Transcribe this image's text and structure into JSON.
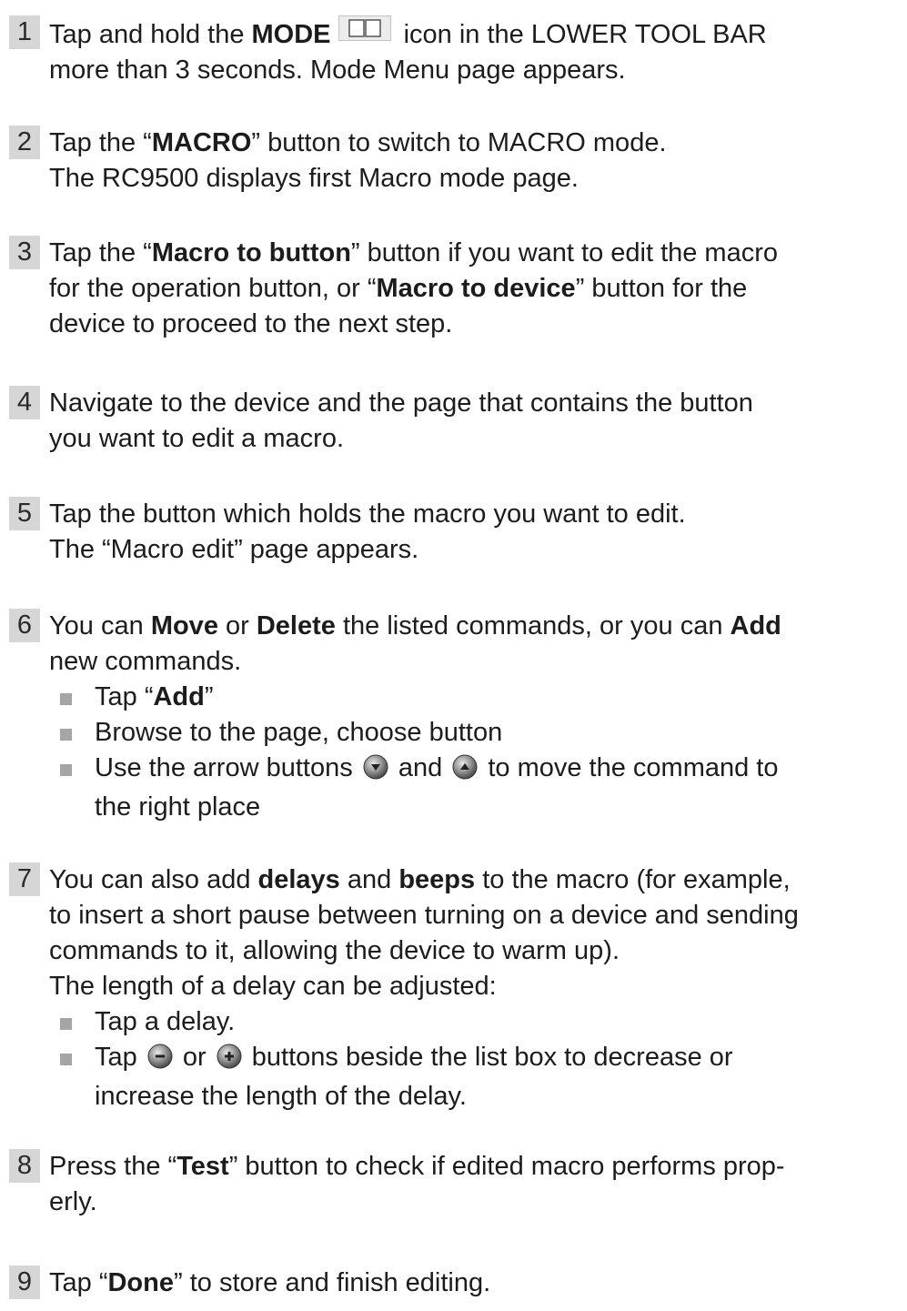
{
  "steps": [
    {
      "num": "1",
      "l1a": "Tap and hold the ",
      "l1b": "MODE",
      "l1c": " icon in the LOWER TOOL BAR",
      "l2": "more than 3 seconds. Mode Menu page appears."
    },
    {
      "num": "2",
      "l1a": "Tap the “",
      "l1b": "MACRO",
      "l1c": "” button to switch to MACRO mode.",
      "l2": "The RC9500 displays first Macro mode page."
    },
    {
      "num": "3",
      "l1a": "Tap the “",
      "l1b": "Macro to button",
      "l1c": "” button if you want to edit the macro",
      "l2a": "for the operation button, or “",
      "l2b": "Macro to device",
      "l2c": "” button for the",
      "l3": "device to proceed to the next step."
    },
    {
      "num": "4",
      "l1": "Navigate to the device and the page that contains the button",
      "l2": "you want to edit a macro."
    },
    {
      "num": "5",
      "l1": "Tap the button which holds the macro you want to edit.",
      "l2": "The “Macro edit” page appears."
    },
    {
      "num": "6",
      "l1a": "You can ",
      "l1b": "Move",
      "l1c": " or ",
      "l1d": "Delete",
      "l1e": " the listed commands, or you can ",
      "l1f": "Add",
      "l2": "new commands.",
      "b1a": "Tap “",
      "b1b": "Add",
      "b1c": "”",
      "b2": "Browse to the page, choose button",
      "b3a": "Use the arrow buttons ",
      "b3b": " and ",
      "b3c": " to move the command to",
      "b3d": "the right place"
    },
    {
      "num": "7",
      "l1a": "You can also add ",
      "l1b": "delays",
      "l1c": " and ",
      "l1d": "beeps",
      "l1e": " to the macro (for example,",
      "l2": "to insert a short pause between turning on a device and sending",
      "l3": "commands to it, allowing the device to warm up).",
      "l4": "The length of a delay can be adjusted:",
      "b1": "Tap a delay.",
      "b2a": "Tap ",
      "b2b": " or ",
      "b2c": " buttons beside the list box to decrease or",
      "b2d": "increase the length of the delay."
    },
    {
      "num": "8",
      "l1a": "Press the “",
      "l1b": "Test",
      "l1c": "” button to check if edited macro performs prop-",
      "l2": "erly."
    },
    {
      "num": "9",
      "l1a": "Tap “",
      "l1b": "Done",
      "l1c": "” to store and finish editing."
    }
  ],
  "icons": {
    "mode": "mode-book-icon",
    "arrow_down": "arrow-down-circle-icon",
    "arrow_up": "arrow-up-circle-icon",
    "minus": "minus-circle-icon",
    "plus": "plus-circle-icon"
  },
  "colors": {
    "step_number_bg": "#d6d6d6",
    "bullet": "#a5a5a5",
    "text": "#1c1c1c"
  }
}
